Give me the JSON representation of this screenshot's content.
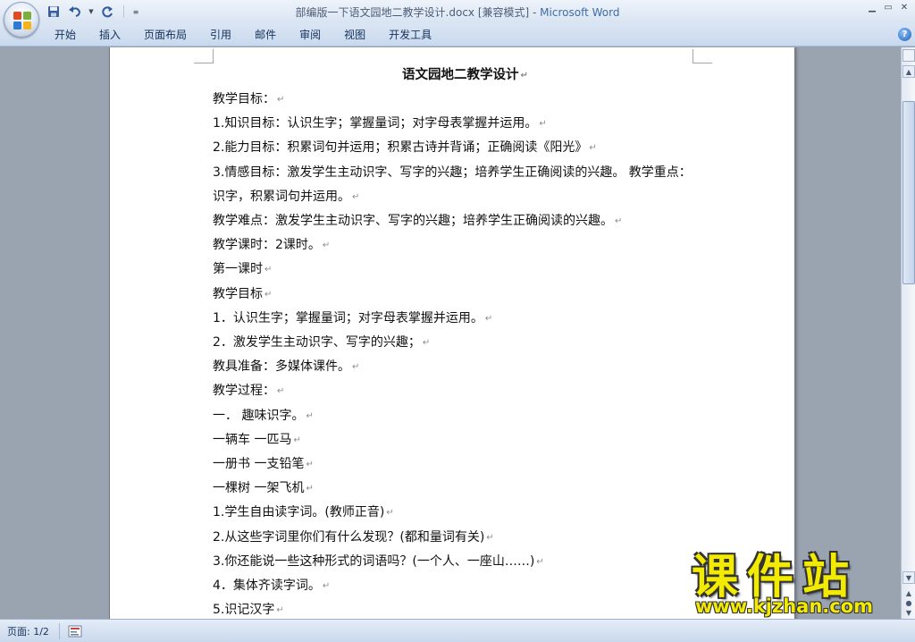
{
  "window": {
    "title_doc": "部编版一下语文园地二教学设计.docx [兼容模式] - ",
    "title_app": "Microsoft Word"
  },
  "ribbon_tabs": [
    "开始",
    "插入",
    "页面布局",
    "引用",
    "邮件",
    "审阅",
    "视图",
    "开发工具"
  ],
  "help_label": "?",
  "document": {
    "heading": "语文园地二教学设计",
    "paragraph_mark": "↵",
    "lines": [
      "教学目标：",
      "1.知识目标：认识生字；掌握量词；对字母表掌握并运用。",
      "2.能力目标：积累词句并运用；积累古诗并背诵；正确阅读《阳光》",
      "3.情感目标：激发学生主动识字、写字的兴趣；培养学生正确阅读的兴趣。 教学重点：识字，积累词句并运用。",
      "教学难点：激发学生主动识字、写字的兴趣；培养学生正确阅读的兴趣。",
      "教学课时：2课时。",
      "第一课时",
      "教学目标",
      "1．认识生字；掌握量词；对字母表掌握并运用。",
      "2．激发学生主动识字、写字的兴趣；",
      "教具准备：多媒体课件。",
      "教学过程：",
      "一．   趣味识字。",
      "一辆车      一匹马",
      "一册书      一支铅笔",
      "一棵树      一架飞机",
      "1.学生自由读字词。(教师正音)",
      "2.从这些字词里你们有什么发现？(都和量词有关)",
      "3.你还能说一些这种形式的词语吗？(一个人、一座山……)",
      "4．集体齐读字词。",
      "5.识记汉字"
    ]
  },
  "status": {
    "page_indicator": "页面: 1/2"
  },
  "watermark": {
    "big": "课件站",
    "url": "www.kjzhan.com"
  },
  "colors": {
    "title_bar": "#dbe6f4",
    "workspace": "#9aa3b0",
    "page": "#ffffff",
    "watermark_yellow": "#f2ea00"
  }
}
